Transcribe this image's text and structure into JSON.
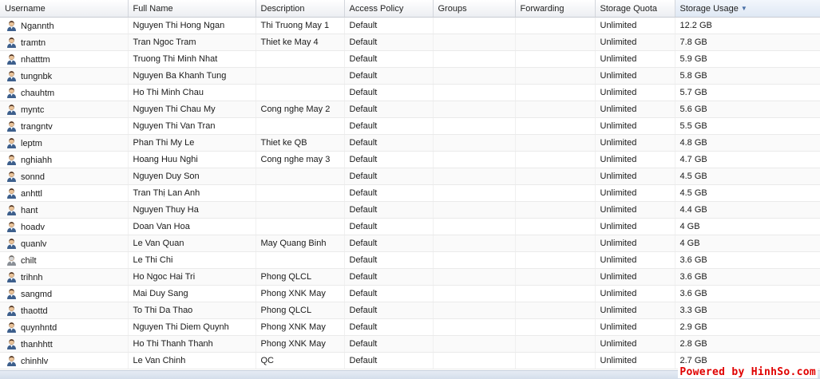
{
  "columns": [
    {
      "key": "username",
      "label": "Username"
    },
    {
      "key": "full_name",
      "label": "Full Name"
    },
    {
      "key": "description",
      "label": "Description"
    },
    {
      "key": "access_policy",
      "label": "Access Policy"
    },
    {
      "key": "groups",
      "label": "Groups"
    },
    {
      "key": "forwarding",
      "label": "Forwarding"
    },
    {
      "key": "storage_quota",
      "label": "Storage Quota"
    },
    {
      "key": "storage_usage",
      "label": "Storage Usage",
      "sorted": "descending"
    }
  ],
  "icons": {
    "user_icon": "user-icon",
    "sort_arrow": "sort-desc-icon"
  },
  "colors": {
    "header_sorted": "#dfe8f4",
    "watermark": "#e00000"
  },
  "rows": [
    {
      "username": "Ngannth",
      "full_name": "Nguyen Thi Hong Ngan",
      "description": "Thi Truong May 1",
      "access_policy": "Default",
      "groups": "",
      "forwarding": "",
      "storage_quota": "Unlimited",
      "storage_usage": "12.2 GB"
    },
    {
      "username": "tramtn",
      "full_name": "Tran Ngoc Tram",
      "description": "Thiet ke May 4",
      "access_policy": "Default",
      "groups": "",
      "forwarding": "",
      "storage_quota": "Unlimited",
      "storage_usage": "7.8 GB"
    },
    {
      "username": "nhatttm",
      "full_name": "Truong Thi Minh Nhat",
      "description": "",
      "access_policy": "Default",
      "groups": "",
      "forwarding": "",
      "storage_quota": "Unlimited",
      "storage_usage": "5.9 GB"
    },
    {
      "username": "tungnbk",
      "full_name": "Nguyen Ba Khanh Tung",
      "description": "",
      "access_policy": "Default",
      "groups": "",
      "forwarding": "",
      "storage_quota": "Unlimited",
      "storage_usage": "5.8 GB"
    },
    {
      "username": "chauhtm",
      "full_name": "Ho Thi Minh Chau",
      "description": "",
      "access_policy": "Default",
      "groups": "",
      "forwarding": "",
      "storage_quota": "Unlimited",
      "storage_usage": "5.7 GB"
    },
    {
      "username": "myntc",
      "full_name": "Nguyen Thi Chau My",
      "description": "Cong nghẹ May 2",
      "access_policy": "Default",
      "groups": "",
      "forwarding": "",
      "storage_quota": "Unlimited",
      "storage_usage": "5.6 GB"
    },
    {
      "username": "trangntv",
      "full_name": "Nguyen Thi Van Tran",
      "description": "",
      "access_policy": "Default",
      "groups": "",
      "forwarding": "",
      "storage_quota": "Unlimited",
      "storage_usage": "5.5 GB"
    },
    {
      "username": "leptm",
      "full_name": "Phan Thi My Le",
      "description": "Thiet ke QB",
      "access_policy": "Default",
      "groups": "",
      "forwarding": "",
      "storage_quota": "Unlimited",
      "storage_usage": "4.8 GB"
    },
    {
      "username": "nghiahh",
      "full_name": "Hoang Huu Nghi",
      "description": "Cong nghe may 3",
      "access_policy": "Default",
      "groups": "",
      "forwarding": "",
      "storage_quota": "Unlimited",
      "storage_usage": "4.7 GB"
    },
    {
      "username": "sonnd",
      "full_name": "Nguyen Duy Son",
      "description": "",
      "access_policy": "Default",
      "groups": "",
      "forwarding": "",
      "storage_quota": "Unlimited",
      "storage_usage": "4.5 GB"
    },
    {
      "username": "anhttl",
      "full_name": "Tran Thị Lan Anh",
      "description": "",
      "access_policy": "Default",
      "groups": "",
      "forwarding": "",
      "storage_quota": "Unlimited",
      "storage_usage": "4.5 GB"
    },
    {
      "username": "hant",
      "full_name": "Nguyen Thuy Ha",
      "description": "",
      "access_policy": "Default",
      "groups": "",
      "forwarding": "",
      "storage_quota": "Unlimited",
      "storage_usage": "4.4 GB"
    },
    {
      "username": "hoadv",
      "full_name": "Doan Van Hoa",
      "description": "",
      "access_policy": "Default",
      "groups": "",
      "forwarding": "",
      "storage_quota": "Unlimited",
      "storage_usage": "4 GB"
    },
    {
      "username": "quanlv",
      "full_name": "Le Van Quan",
      "description": "May Quang Binh",
      "access_policy": "Default",
      "groups": "",
      "forwarding": "",
      "storage_quota": "Unlimited",
      "storage_usage": "4 GB"
    },
    {
      "username": "chilt",
      "full_name": "Le Thi Chi",
      "description": "",
      "access_policy": "Default",
      "groups": "",
      "forwarding": "",
      "storage_quota": "Unlimited",
      "storage_usage": "3.6 GB",
      "disabled": true
    },
    {
      "username": "trihnh",
      "full_name": "Ho Ngoc Hai Tri",
      "description": "Phong QLCL",
      "access_policy": "Default",
      "groups": "",
      "forwarding": "",
      "storage_quota": "Unlimited",
      "storage_usage": "3.6 GB"
    },
    {
      "username": "sangmd",
      "full_name": "Mai Duy Sang",
      "description": "Phong XNK May",
      "access_policy": "Default",
      "groups": "",
      "forwarding": "",
      "storage_quota": "Unlimited",
      "storage_usage": "3.6 GB"
    },
    {
      "username": "thaottd",
      "full_name": "To Thi Da Thao",
      "description": "Phong QLCL",
      "access_policy": "Default",
      "groups": "",
      "forwarding": "",
      "storage_quota": "Unlimited",
      "storage_usage": "3.3 GB"
    },
    {
      "username": "quynhntd",
      "full_name": "Nguyen Thi Diem Quynh",
      "description": "Phong XNK May",
      "access_policy": "Default",
      "groups": "",
      "forwarding": "",
      "storage_quota": "Unlimited",
      "storage_usage": "2.9 GB"
    },
    {
      "username": "thanhhtt",
      "full_name": "Ho Thi Thanh Thanh",
      "description": "Phong XNK May",
      "access_policy": "Default",
      "groups": "",
      "forwarding": "",
      "storage_quota": "Unlimited",
      "storage_usage": "2.8 GB"
    },
    {
      "username": "chinhlv",
      "full_name": "Le Van Chinh",
      "description": "QC",
      "access_policy": "Default",
      "groups": "",
      "forwarding": "",
      "storage_quota": "Unlimited",
      "storage_usage": "2.7 GB"
    }
  ],
  "watermark": "Powered by HinhSo.com"
}
